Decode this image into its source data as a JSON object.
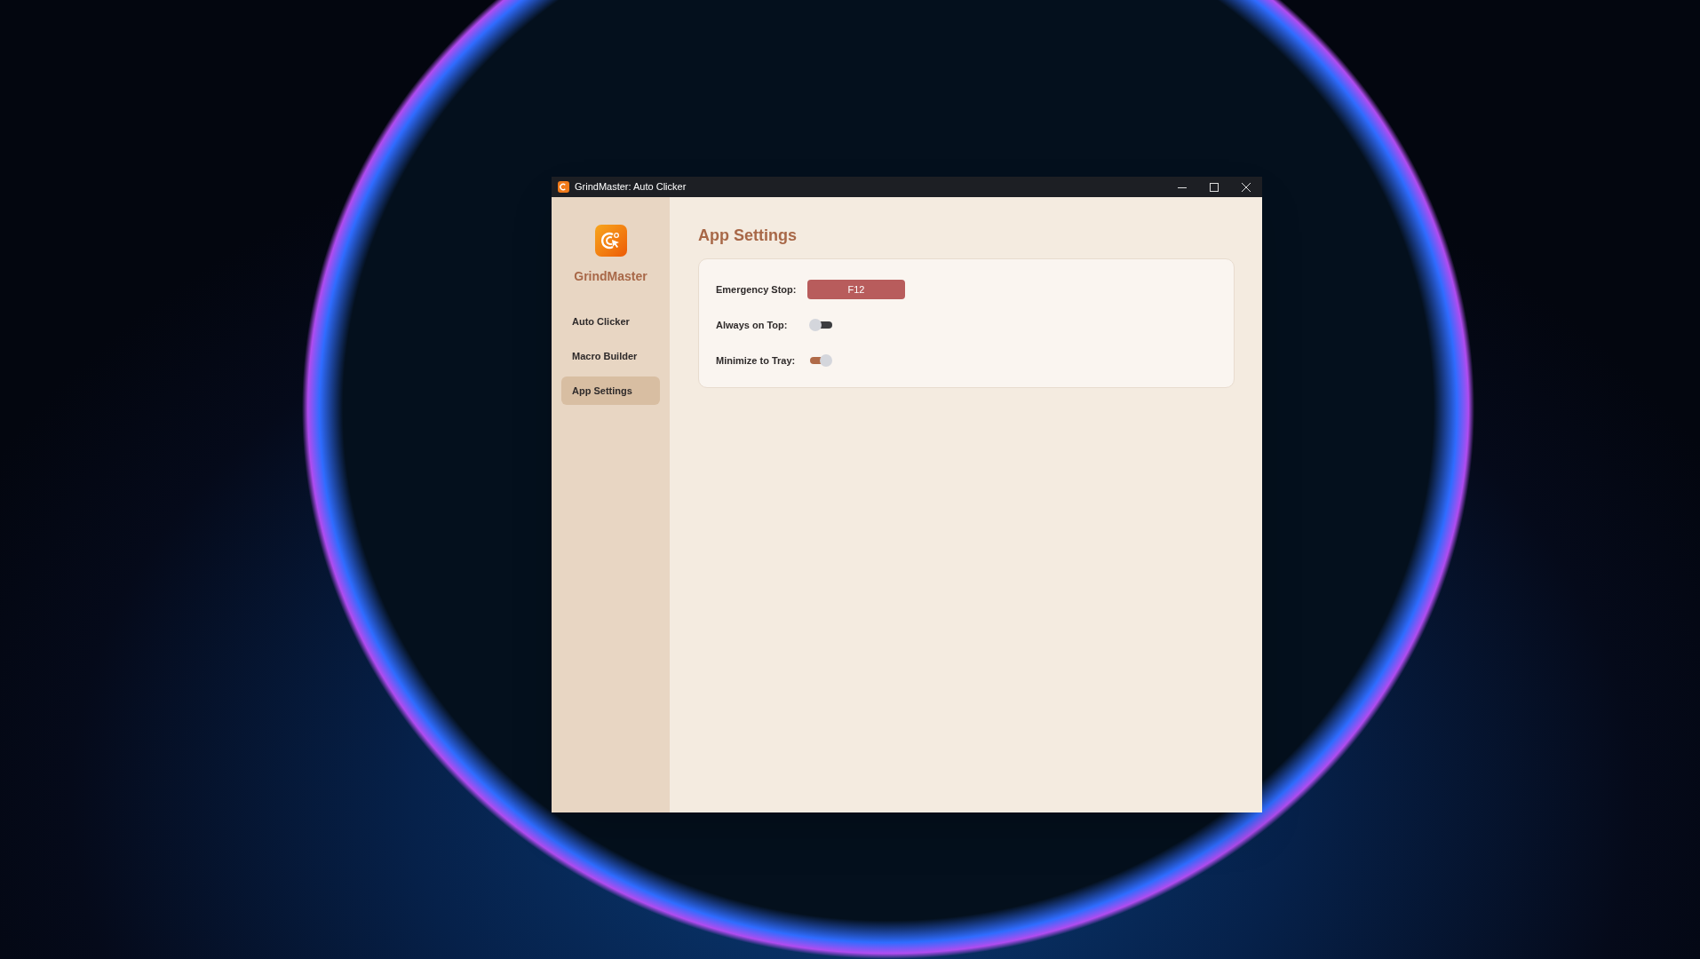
{
  "window": {
    "title": "GrindMaster: Auto Clicker"
  },
  "sidebar": {
    "app_name": "GrindMaster",
    "items": [
      {
        "label": "Auto Clicker",
        "selected": false
      },
      {
        "label": "Macro Builder",
        "selected": false
      },
      {
        "label": "App Settings",
        "selected": true
      }
    ]
  },
  "page": {
    "title": "App Settings",
    "settings": [
      {
        "kind": "hotkey",
        "label": "Emergency Stop:",
        "value": "F12"
      },
      {
        "kind": "toggle",
        "label": "Always on Top:",
        "on": false
      },
      {
        "kind": "toggle",
        "label": "Minimize to Tray:",
        "on": true
      }
    ]
  }
}
